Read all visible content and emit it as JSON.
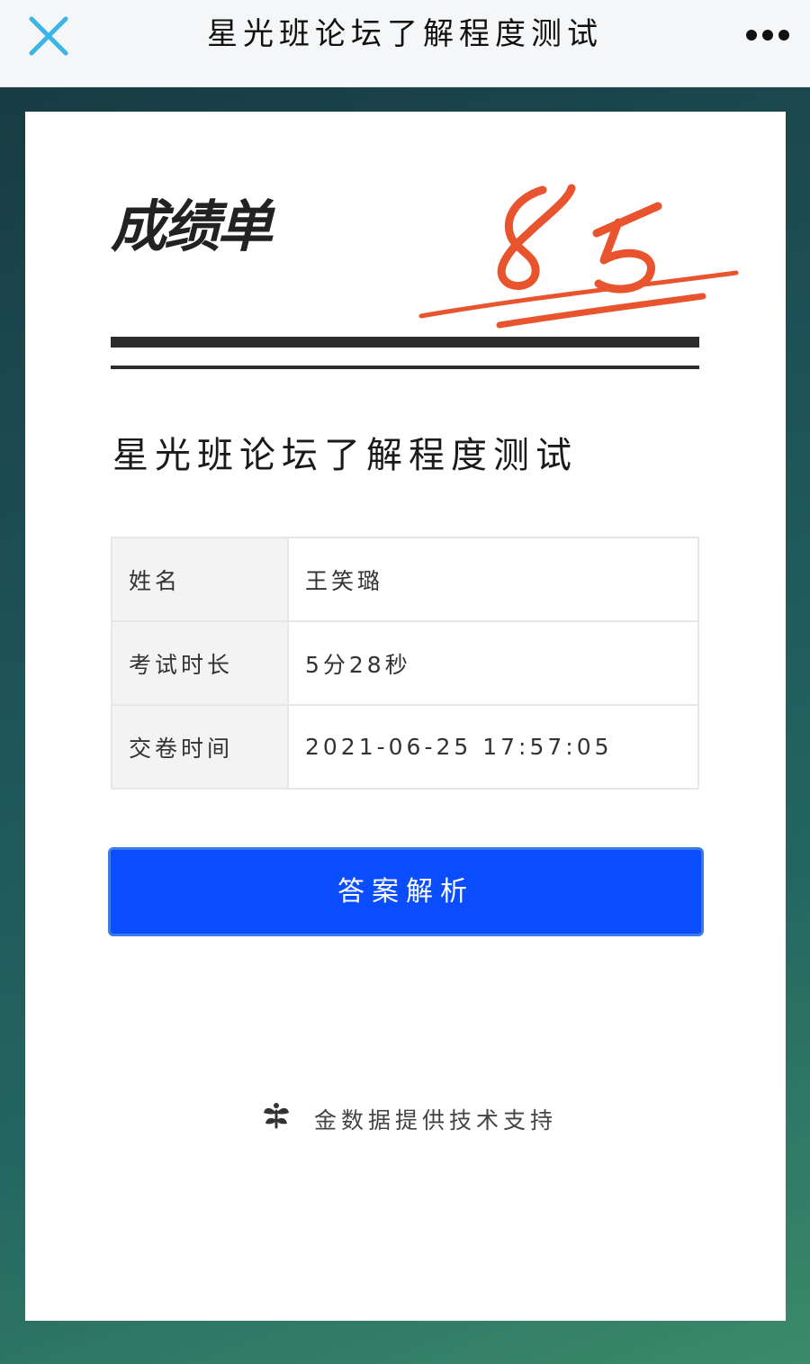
{
  "topbar": {
    "title": "星光班论坛了解程度测试",
    "close_icon": "close-icon",
    "more_icon": "more-dots-icon",
    "close_color": "#3bb4e6"
  },
  "report": {
    "heading": "成绩单",
    "score": "85",
    "score_color": "#e8542e",
    "quiz_title": "星光班论坛了解程度测试",
    "rows": [
      {
        "label": "姓名",
        "value": "王笑璐"
      },
      {
        "label": "考试时长",
        "value": "5分28秒"
      },
      {
        "label": "交卷时间",
        "value": "2021-06-25 17:57:05"
      }
    ],
    "answer_button": "答案解析",
    "button_color": "#0a4dff"
  },
  "footer": {
    "text": "金数据提供技术支持",
    "logo_icon": "jinshuju-logo-icon"
  }
}
